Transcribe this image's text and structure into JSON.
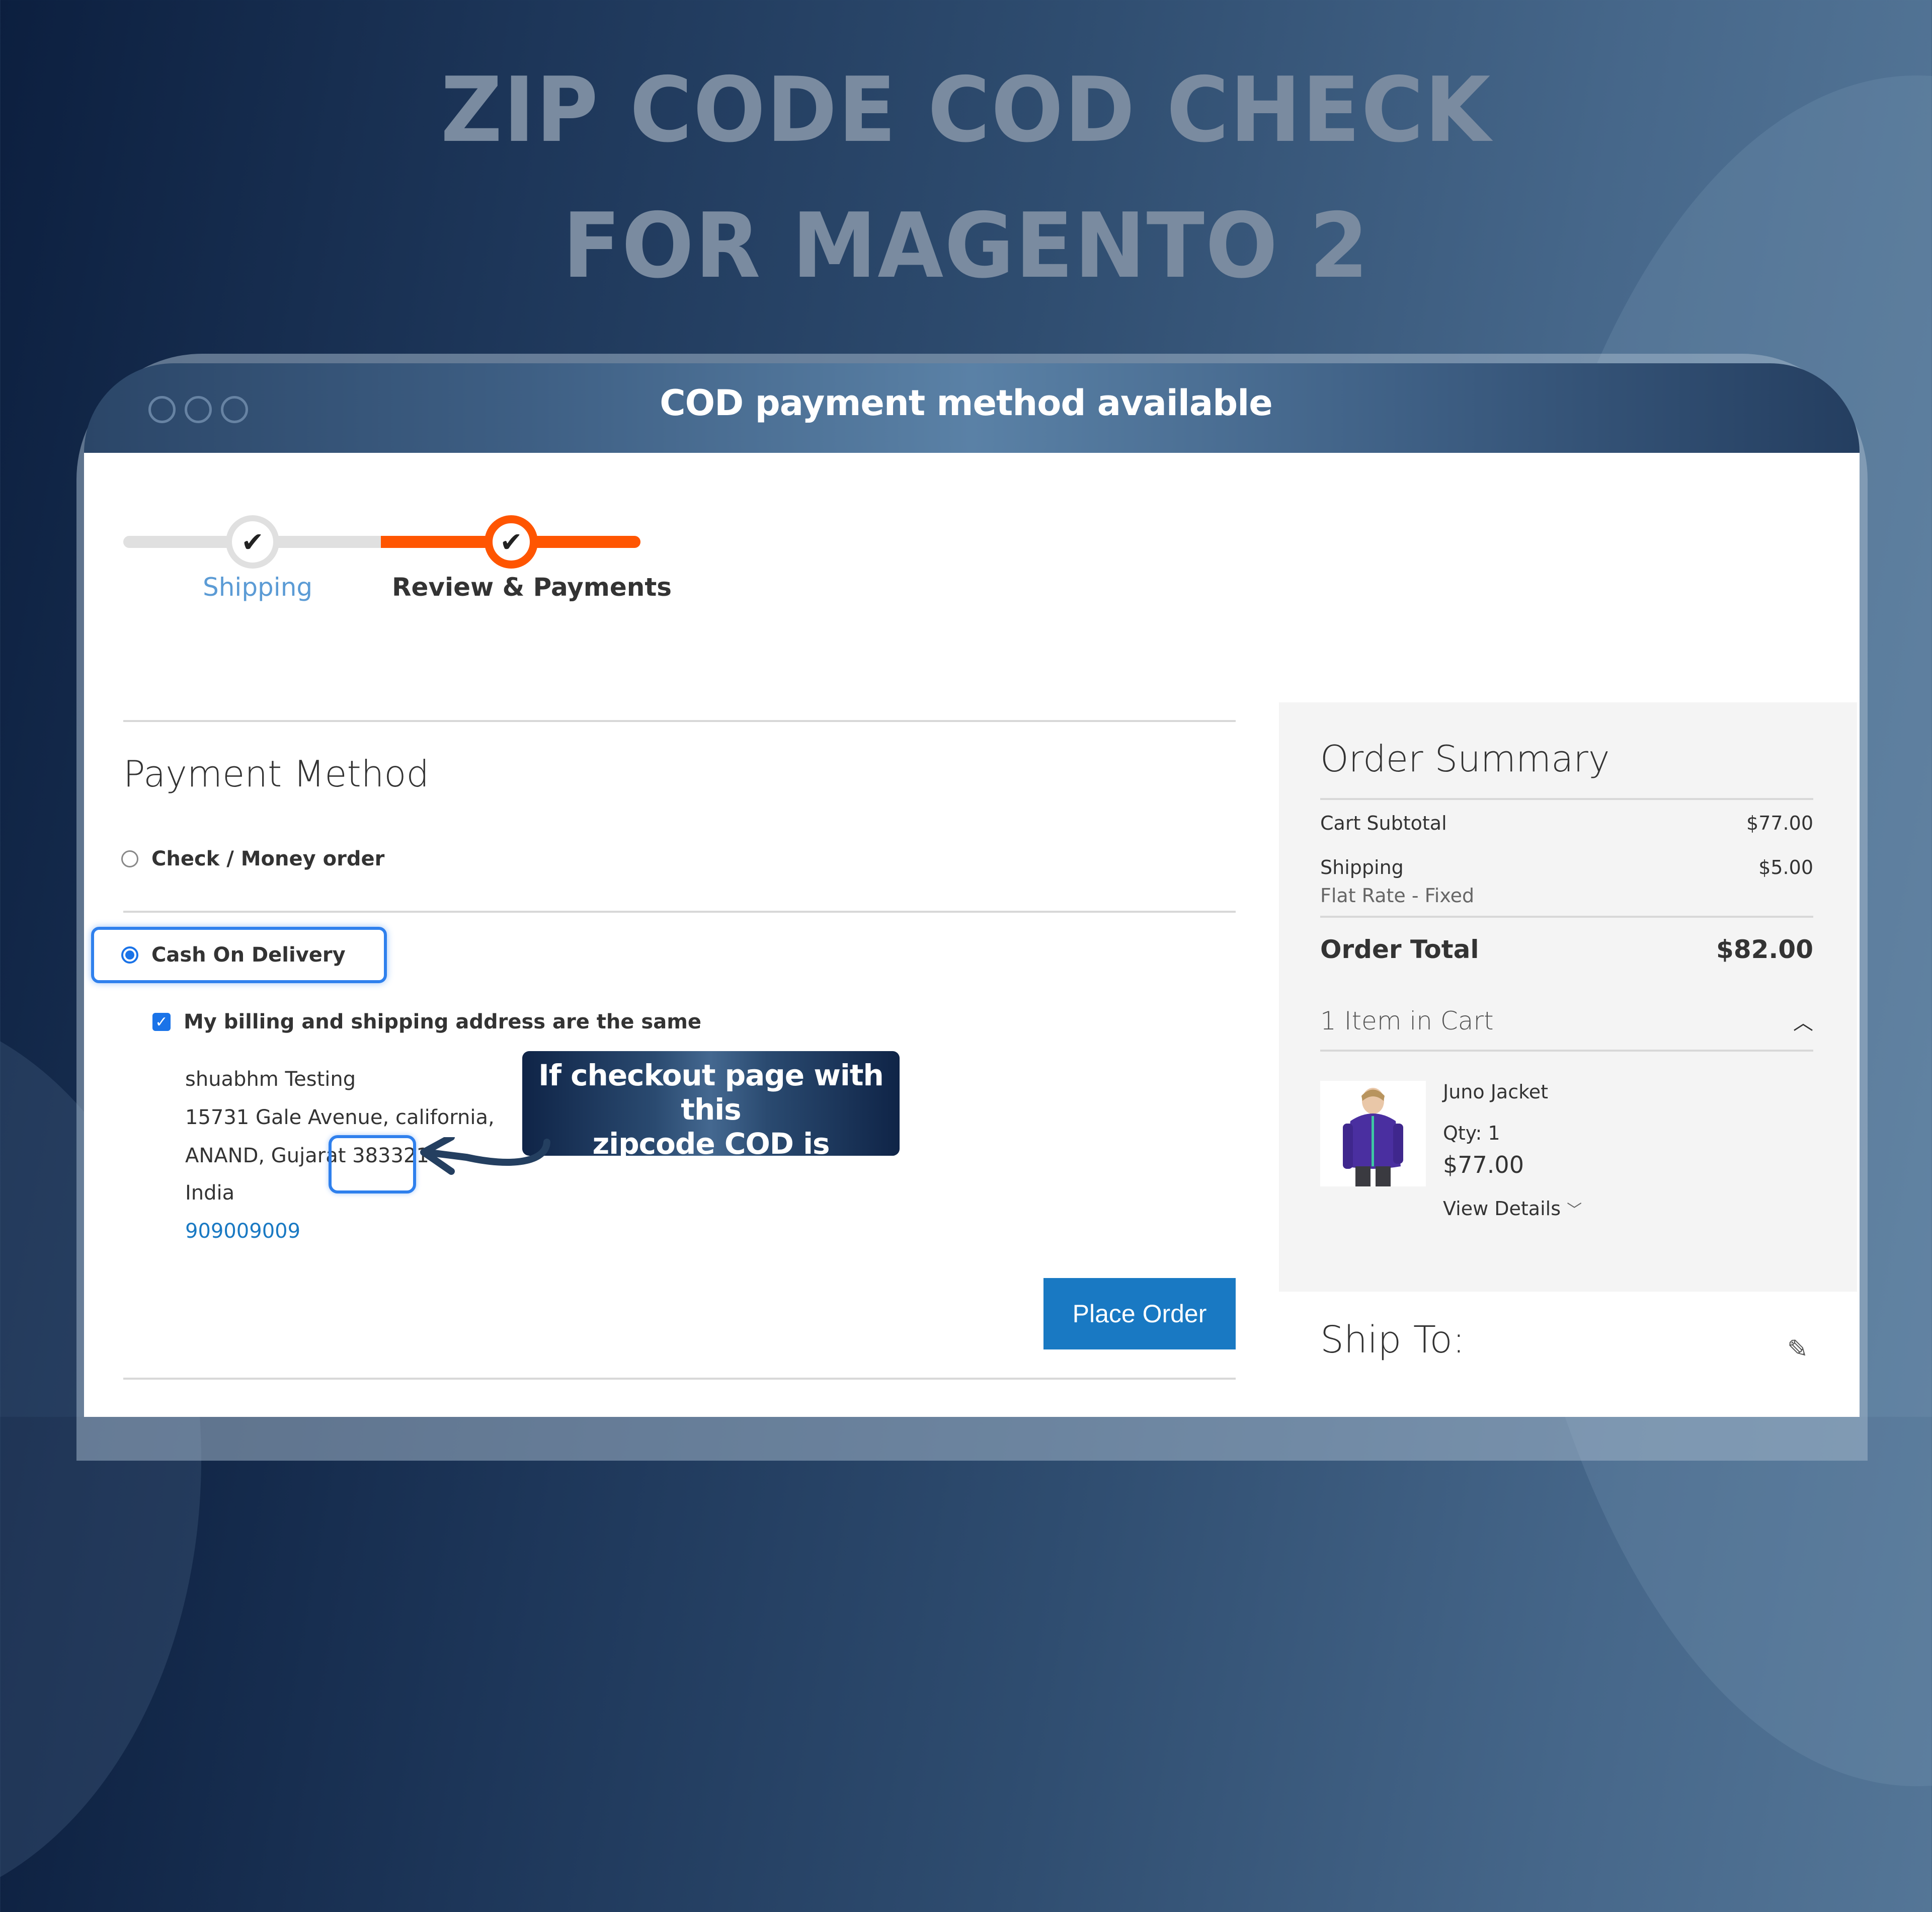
{
  "hero": {
    "title_line1": "ZIP CODE COD CHECK",
    "title_line2": "FOR MAGENTO 2"
  },
  "window": {
    "header_title": "COD payment method available"
  },
  "progress": {
    "steps": [
      {
        "label": "Shipping",
        "state": "completed"
      },
      {
        "label": "Review & Payments",
        "state": "active"
      }
    ],
    "check_glyph": "✔"
  },
  "payment": {
    "title": "Payment Method",
    "options": [
      {
        "label": "Check / Money order",
        "selected": false
      },
      {
        "label": "Cash On Delivery",
        "selected": true
      }
    ],
    "billing_same_label": "My billing and shipping address are the same",
    "billing_same_checked": true,
    "address": {
      "name": "shuabhm Testing",
      "street": "15731 Gale Avenue, california,",
      "city_region": "ANAND, Gujarat",
      "zip": "383321",
      "country": "India",
      "phone": "909009009"
    },
    "place_order_label": "Place Order"
  },
  "callout": {
    "text_line1": "If checkout page with this",
    "text_line2": "zipcode COD is available"
  },
  "summary": {
    "title": "Order Summary",
    "cart_subtotal_label": "Cart Subtotal",
    "cart_subtotal_value": "$77.00",
    "shipping_label": "Shipping",
    "shipping_value": "$5.00",
    "shipping_method": "Flat Rate - Fixed",
    "order_total_label": "Order Total",
    "order_total_value": "$82.00",
    "items_in_cart_label": "1 Item in Cart",
    "item": {
      "name": "Juno Jacket",
      "qty_label": "Qty: 1",
      "price": "$77.00",
      "view_details_label": "View Details"
    }
  },
  "ship_to": {
    "title": "Ship To:"
  },
  "colors": {
    "accent_orange": "#ff5501",
    "link_blue": "#1979c3",
    "highlight_blue": "#2f80ed",
    "button_blue": "#1979c3"
  }
}
